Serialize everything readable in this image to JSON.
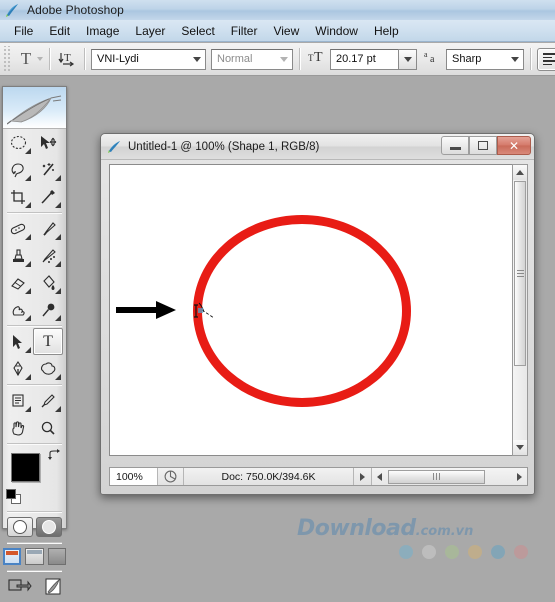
{
  "app": {
    "title": "Adobe Photoshop",
    "logo_icon": "photoshop-feather-icon"
  },
  "menubar": {
    "items": [
      {
        "label": "File"
      },
      {
        "label": "Edit"
      },
      {
        "label": "Image"
      },
      {
        "label": "Layer"
      },
      {
        "label": "Select"
      },
      {
        "label": "Filter"
      },
      {
        "label": "View"
      },
      {
        "label": "Window"
      },
      {
        "label": "Help"
      }
    ]
  },
  "options_bar": {
    "tool_preset_glyph": "T",
    "tool_preset_icon": "type-tool-icon",
    "orientation_icon": "text-orientation-icon",
    "font_family": {
      "value": "VNI-Lydi",
      "placeholder": "VNI-Lydi"
    },
    "font_style": {
      "value": "Normal",
      "placeholder": "Normal",
      "enabled": false
    },
    "font_size_icon": "font-size-icon",
    "font_size": {
      "value": "20.17 pt",
      "placeholder": "20.17 pt"
    },
    "antialias_icon": "anti-alias-icon",
    "antialias": {
      "value": "Sharp",
      "placeholder": "Sharp"
    },
    "align_left_icon": "align-left-icon",
    "align_center_icon": "align-center-icon"
  },
  "toolbox": {
    "header_icon": "feather-banner-icon",
    "tools": [
      {
        "name": "elliptical-marquee-tool",
        "glyph": "◯",
        "has_flyout": true,
        "selected": false
      },
      {
        "name": "move-tool",
        "glyph": "➤",
        "has_flyout": false,
        "selected": false
      },
      {
        "name": "lasso-tool",
        "glyph": "❀",
        "has_flyout": true,
        "selected": false
      },
      {
        "name": "magic-wand-tool",
        "glyph": "✳",
        "has_flyout": true,
        "selected": false
      },
      {
        "name": "crop-tool",
        "glyph": "⌗",
        "has_flyout": true,
        "selected": false
      },
      {
        "name": "slice-tool",
        "glyph": "✂",
        "has_flyout": true,
        "selected": false
      },
      {
        "name": "healing-brush-tool",
        "glyph": "⌒",
        "has_flyout": true,
        "selected": false
      },
      {
        "name": "brush-tool",
        "glyph": "✐",
        "has_flyout": true,
        "selected": false
      },
      {
        "name": "clone-stamp-tool",
        "glyph": "⚲",
        "has_flyout": true,
        "selected": false
      },
      {
        "name": "history-brush-tool",
        "glyph": "✎",
        "has_flyout": true,
        "selected": false
      },
      {
        "name": "eraser-tool",
        "glyph": "▱",
        "has_flyout": true,
        "selected": false
      },
      {
        "name": "gradient-paint-bucket-tool",
        "glyph": "◔",
        "has_flyout": true,
        "selected": false
      },
      {
        "name": "blur-smudge-tool",
        "glyph": "☟",
        "has_flyout": true,
        "selected": false
      },
      {
        "name": "dodge-burn-tool",
        "glyph": "⚫",
        "has_flyout": true,
        "selected": false
      },
      {
        "name": "path-selection-tool",
        "glyph": "➤",
        "has_flyout": true,
        "selected": false
      },
      {
        "name": "horizontal-type-tool",
        "glyph": "T",
        "has_flyout": false,
        "selected": true
      },
      {
        "name": "pen-tool",
        "glyph": "✑",
        "has_flyout": true,
        "selected": false
      },
      {
        "name": "custom-shape-tool",
        "glyph": "☁",
        "has_flyout": true,
        "selected": false
      },
      {
        "name": "notes-tool",
        "glyph": "☰",
        "has_flyout": true,
        "selected": false
      },
      {
        "name": "eyedropper-tool",
        "glyph": "⚗",
        "has_flyout": true,
        "selected": false
      },
      {
        "name": "hand-tool",
        "glyph": "✋",
        "has_flyout": false,
        "selected": false
      },
      {
        "name": "zoom-tool",
        "glyph": "⚲",
        "has_flyout": false,
        "selected": false
      }
    ],
    "colors": {
      "foreground": "#000000",
      "background": "#ffffff",
      "swap_icon": "swap-colors-icon",
      "default_icon": "default-colors-icon"
    },
    "mask_modes": [
      {
        "name": "standard-mask-mode",
        "selected": true
      },
      {
        "name": "quick-mask-mode",
        "selected": false
      }
    ],
    "screen_modes": [
      {
        "name": "standard-screen-mode",
        "selected": true
      },
      {
        "name": "full-screen-with-menubar-mode",
        "selected": false
      },
      {
        "name": "full-screen-mode",
        "selected": false
      }
    ],
    "jump_to": [
      {
        "name": "jump-to-imageready-icon"
      },
      {
        "name": "jump-to-feather-icon"
      }
    ]
  },
  "document_window": {
    "icon": "document-photoshop-icon",
    "title": "Untitled-1 @ 100% (Shape 1, RGB/8)",
    "window_controls": {
      "minimize_label": "─",
      "restore_label": "□",
      "close_label": "✕"
    },
    "canvas": {
      "background": "#ffffff",
      "shape": {
        "name": "red-ellipse-path",
        "stroke_color": "#e81c15",
        "stroke_width": 9,
        "fill": "none"
      },
      "annotation_arrow": {
        "name": "pointer-arrow-annotation",
        "color": "#000000",
        "points_to": "text-cursor-on-path"
      },
      "text_cursor": {
        "name": "type-on-path-cursor",
        "label": ""
      }
    },
    "status_bar": {
      "zoom_value": "100%",
      "thumb_icon": "status-preview-icon",
      "doc_info": "Doc: 750.0K/394.6K",
      "more_icon": "status-more-arrow-icon"
    },
    "scrollbars": {
      "vertical": {
        "name": "vertical-scrollbar"
      },
      "horizontal": {
        "name": "horizontal-scrollbar"
      }
    }
  },
  "watermark": {
    "brand": "Download",
    "suffix": ".com.vn",
    "dot_colors": [
      "#4db8e8",
      "#ededed",
      "#a8d97a",
      "#f2b84b",
      "#2f9ed4",
      "#e8767a"
    ]
  }
}
